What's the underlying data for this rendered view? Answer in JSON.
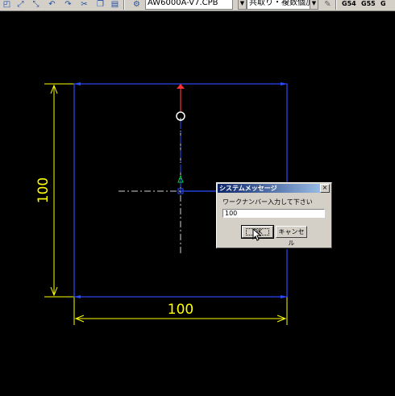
{
  "toolbar": {
    "file_combo_value": "AW6000A-V7.CPB",
    "mode_combo_value": "共取り・複数個加工",
    "gcode_labels": [
      "G54",
      "G55",
      "G"
    ],
    "icons": [
      "select-icon",
      "arc-icon",
      "line-icon",
      "undo-icon",
      "redo-icon",
      "cut-icon",
      "copy-icon",
      "paste-icon",
      "settings-icon",
      "help-icon"
    ]
  },
  "drawing": {
    "dim_vertical": "100",
    "dim_horizontal": "100",
    "colors": {
      "outline": "#2040ff",
      "dimension": "#ffff00",
      "centerline": "#ffffff",
      "toolpath_start": "#ff3030",
      "direction_arrow": "#00d040"
    }
  },
  "dialog": {
    "title": "システムメッセージ",
    "message": "ワークナンバー入力して下さい",
    "input_value": "100",
    "ok_label": "OK",
    "cancel_label": "キャンセル",
    "close_glyph": "×"
  }
}
